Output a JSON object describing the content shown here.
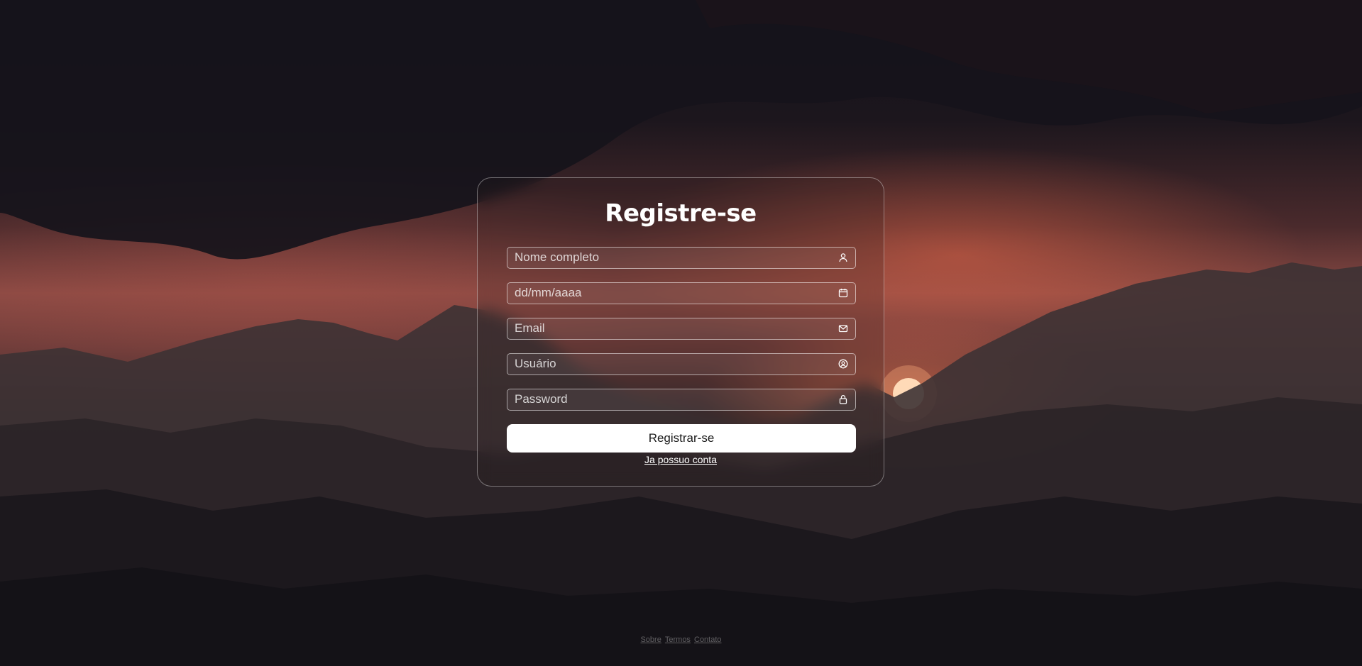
{
  "form": {
    "title": "Registre-se",
    "fields": [
      {
        "placeholder": "Nome completo",
        "icon": "user-icon"
      },
      {
        "placeholder": "dd/mm/aaaa",
        "icon": "calendar-icon"
      },
      {
        "placeholder": "Email",
        "icon": "mail-icon"
      },
      {
        "placeholder": "Usuário",
        "icon": "user-circle-icon"
      },
      {
        "placeholder": "Password",
        "icon": "lock-icon"
      }
    ],
    "submit_label": "Registrar-se",
    "login_link": "Ja possuo conta"
  },
  "footer": {
    "links": [
      "Sobre",
      "Termos",
      "Contato"
    ]
  },
  "colors": {
    "card_border": "#ffffff",
    "button_bg": "#ffffff",
    "button_text": "#1a1a1a"
  }
}
